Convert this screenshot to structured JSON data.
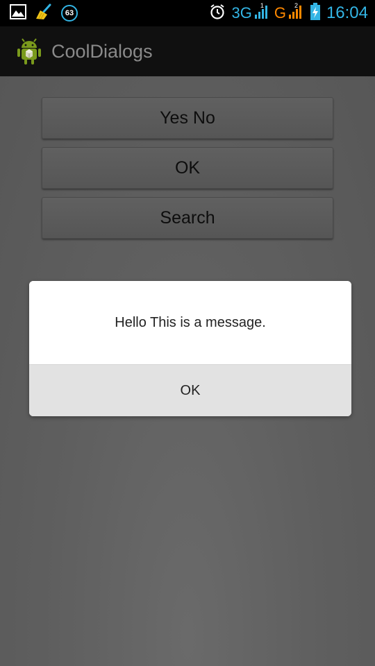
{
  "status_bar": {
    "notification_count": "63",
    "network_1": "3G",
    "network_2": "G",
    "sim_1": "1",
    "sim_2": "2",
    "time": "16:04",
    "icons": [
      "image-icon",
      "broom-icon",
      "notification-count-icon",
      "alarm-icon",
      "signal-icon",
      "signal-icon",
      "battery-charging-icon"
    ]
  },
  "action_bar": {
    "title": "CoolDialogs",
    "icon": "android-icon"
  },
  "main": {
    "buttons": [
      {
        "label": "Yes No"
      },
      {
        "label": "OK"
      },
      {
        "label": "Search"
      }
    ]
  },
  "dialog": {
    "message": "Hello This is a message.",
    "ok_label": "OK"
  },
  "colors": {
    "status_accent": "#33b5e5",
    "network_2_color": "#ff8800",
    "action_bar_bg": "#101010",
    "dialog_bg": "#ffffff",
    "dialog_button_bg": "#e2e2e2"
  }
}
